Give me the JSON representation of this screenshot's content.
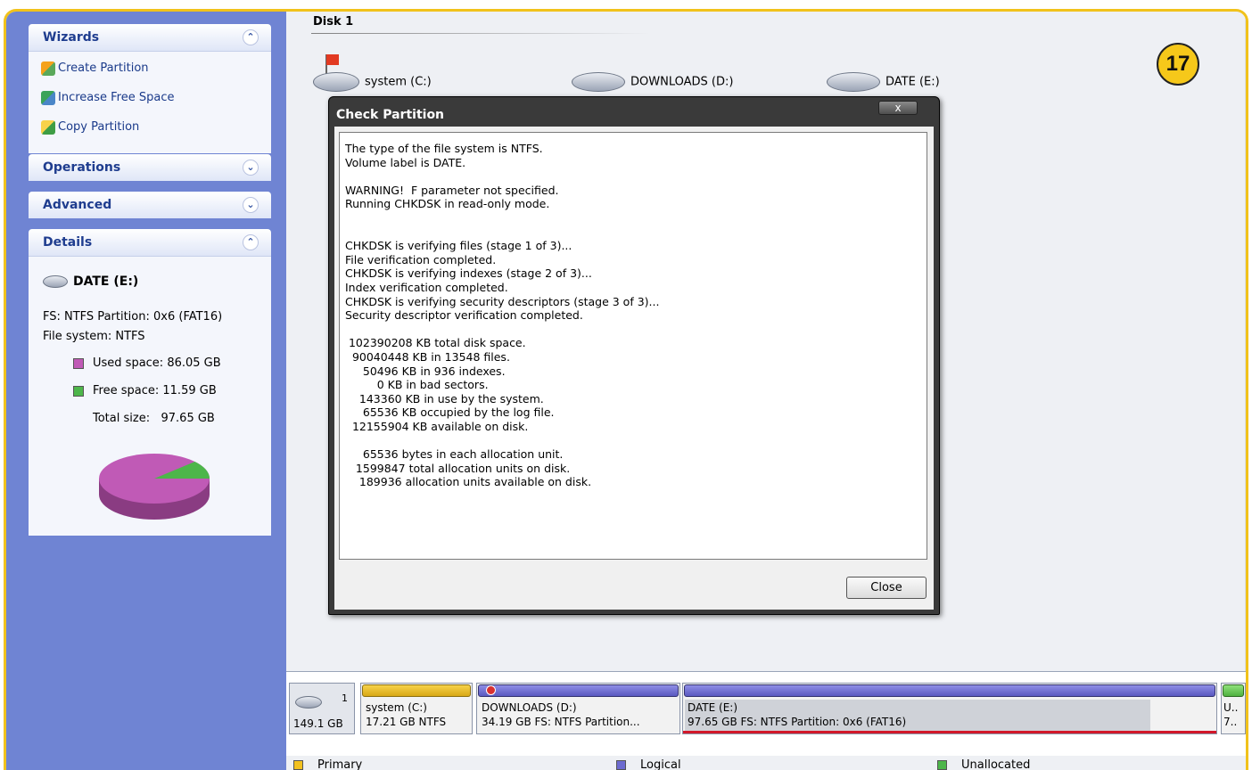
{
  "left_pane": {
    "wizards": {
      "title": "Wizards",
      "items": [
        "Create Partition",
        "Increase Free Space",
        "Copy Partition"
      ]
    },
    "operations": {
      "title": "Operations"
    },
    "advanced": {
      "title": "Advanced"
    },
    "details": {
      "title": "Details",
      "drive": "DATE (E:)",
      "fs_line": "FS: NTFS Partition: 0x6 (FAT16)",
      "filesystem_line": "File system: NTFS",
      "used_label": "Used space:",
      "used_value": "86.05 GB",
      "free_label": "Free space:",
      "free_value": "11.59 GB",
      "total_label": "Total size:",
      "total_value": "97.65 GB",
      "used_fraction": 0.8812,
      "colors": {
        "used": "#c05ab6",
        "free": "#4db64a"
      }
    }
  },
  "main": {
    "disk_title": "Disk 1",
    "drives": [
      "system (C:)",
      "DOWNLOADS (D:)",
      "DATE (E:)"
    ],
    "badge": "17"
  },
  "dialog": {
    "title": "Check Partition",
    "close_x": "x",
    "text": "The type of the file system is NTFS.\nVolume label is DATE.\n\nWARNING!  F parameter not specified.\nRunning CHKDSK in read-only mode.\n\n\nCHKDSK is verifying files (stage 1 of 3)...\nFile verification completed.\nCHKDSK is verifying indexes (stage 2 of 3)...\nIndex verification completed.\nCHKDSK is verifying security descriptors (stage 3 of 3)...\nSecurity descriptor verification completed.\n\n 102390208 KB total disk space.\n  90040448 KB in 13548 files.\n     50496 KB in 936 indexes.\n         0 KB in bad sectors.\n    143360 KB in use by the system.\n     65536 KB occupied by the log file.\n  12155904 KB available on disk.\n\n     65536 bytes in each allocation unit.\n   1599847 total allocation units on disk.\n    189936 allocation units available on disk.",
    "close_button": "Close"
  },
  "disk_map": {
    "disk_number": "1",
    "disk_size": "149.1 GB",
    "partitions": [
      {
        "name": "system (C:)",
        "info": "17.21 GB  NTFS",
        "type": "primary"
      },
      {
        "name": "DOWNLOADS (D:)",
        "info": "34.19 GB  FS: NTFS Partition...",
        "type": "logical"
      },
      {
        "name": "DATE (E:)",
        "info": "97.65 GB  FS: NTFS Partition: 0x6 (FAT16)",
        "type": "logical"
      },
      {
        "name": "U..",
        "info": "7..",
        "type": "unallocated"
      }
    ]
  },
  "legend": {
    "primary": "Primary",
    "logical": "Logical",
    "unallocated": "Unallocated",
    "colors": {
      "primary": "#f2c11f",
      "logical": "#6d6bd0",
      "unallocated": "#4db64a"
    }
  }
}
